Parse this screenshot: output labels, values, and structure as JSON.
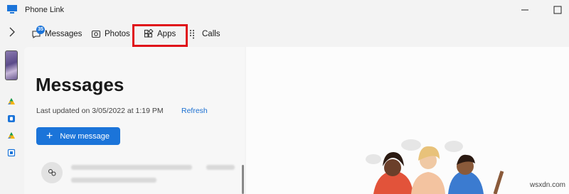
{
  "window": {
    "title": "Phone Link",
    "minimize_glyph": "—",
    "maximize_glyph": "□"
  },
  "nav": {
    "expand_icon": "chevron-right-icon",
    "tabs": [
      {
        "label": "Messages",
        "icon": "message-icon",
        "badge": "35"
      },
      {
        "label": "Photos",
        "icon": "photos-icon"
      },
      {
        "label": "Apps",
        "icon": "apps-icon"
      },
      {
        "label": "Calls",
        "icon": "dialpad-icon"
      }
    ],
    "highlight_color": "#e0121a"
  },
  "main": {
    "heading": "Messages",
    "last_updated": "Last updated on 3/05/2022 at 1:19 PM",
    "refresh_label": "Refresh",
    "new_message_label": "New message",
    "accent": "#1b74d9"
  },
  "watermark": "wsxdn.com"
}
